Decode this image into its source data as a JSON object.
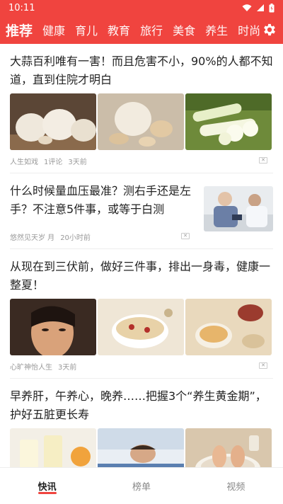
{
  "status": {
    "time": "10:11"
  },
  "tabs": [
    {
      "label": "推荐",
      "active": true
    },
    {
      "label": "健康"
    },
    {
      "label": "育儿"
    },
    {
      "label": "教育"
    },
    {
      "label": "旅行"
    },
    {
      "label": "美食"
    },
    {
      "label": "养生"
    },
    {
      "label": "时尚"
    }
  ],
  "articles": [
    {
      "title": "大蒜百利唯有一害！而且危害不小，90%的人都不知道，直到住院才明白",
      "source": "人生如戏",
      "comments": "1评论",
      "time": "3天前"
    },
    {
      "title": "什么时候量血压最准？测右手还是左手？不注意5件事，或等于白测",
      "source": "悠然见天岁 月",
      "comments": "",
      "time": "20小时前"
    },
    {
      "title": "从现在到三伏前，做好三件事，排出一身毒，健康一整夏！",
      "source": "心旷神怡人生",
      "comments": "",
      "time": "3天前"
    },
    {
      "title": "早养肝，午养心，晚养……把握3个“养生黄金期”，护好五脏更长寿"
    }
  ],
  "close_label": "✕",
  "bottom_nav": [
    {
      "label": "快讯",
      "active": true
    },
    {
      "label": "榜单"
    },
    {
      "label": "视频"
    }
  ],
  "colors": {
    "brand": "#f0443f"
  }
}
